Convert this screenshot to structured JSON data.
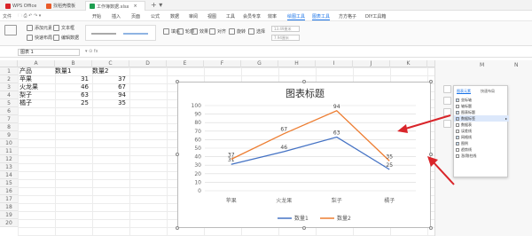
{
  "titlebar": {
    "app_label": "WPS Office",
    "tab1": "找稻壳模板",
    "tab2": "工作簿数据.xlsx"
  },
  "menu": [
    "文件",
    "开始",
    "插入",
    "页面",
    "公式",
    "数据",
    "审阅",
    "视图",
    "工具",
    "会员专享",
    "效率",
    "绘图工具",
    "图表工具",
    "方方格子",
    "DIY工具箱"
  ],
  "toolbar": {
    "add_element": "添加元素",
    "quick_layout": "快速布局",
    "text_box": "文本框",
    "edit_data": "编辑数据",
    "fill": "填充",
    "outline": "轮廓",
    "effect": "效果",
    "align": "对齐",
    "rotate": "旋转",
    "select": "选择",
    "width_label": "13.49厘米",
    "height_label": "7.94厘米"
  },
  "namebox": "图表 1",
  "columns": [
    "A",
    "B",
    "C",
    "D",
    "E",
    "F",
    "G",
    "H",
    "I",
    "J",
    "K",
    "L",
    "M",
    "N"
  ],
  "rows": [
    "1",
    "2",
    "3",
    "4",
    "5",
    "6",
    "7",
    "8",
    "9",
    "10",
    "11",
    "12",
    "13",
    "14",
    "15",
    "16",
    "17",
    "18",
    "19",
    "20"
  ],
  "table": {
    "header": [
      "产品",
      "数量1",
      "数量2"
    ],
    "data": [
      [
        "苹果",
        "31",
        "37"
      ],
      [
        "火龙果",
        "46",
        "67"
      ],
      [
        "梨子",
        "63",
        "94"
      ],
      [
        "橘子",
        "25",
        "35"
      ]
    ]
  },
  "chart_data": {
    "type": "line",
    "title": "图表标题",
    "categories": [
      "苹果",
      "火龙果",
      "梨子",
      "橘子"
    ],
    "series": [
      {
        "name": "数量1",
        "values": [
          31,
          46,
          63,
          25
        ],
        "color": "#4472c4"
      },
      {
        "name": "数量2",
        "values": [
          37,
          67,
          94,
          35
        ],
        "color": "#ed7d31"
      }
    ],
    "ylim": [
      0,
      100
    ],
    "yticks": [
      "0",
      "10",
      "20",
      "30",
      "40",
      "50",
      "60",
      "70",
      "80",
      "90",
      "100"
    ],
    "legend": "bottom",
    "grid": true
  },
  "panel": {
    "tab_elements": "图表元素",
    "tab_layout": "快速布局",
    "items": [
      {
        "label": "坐标轴",
        "checked": true
      },
      {
        "label": "轴标题",
        "checked": false
      },
      {
        "label": "图表标题",
        "checked": true
      },
      {
        "label": "数据标签",
        "checked": true
      },
      {
        "label": "数据表",
        "checked": false
      },
      {
        "label": "误差线",
        "checked": false
      },
      {
        "label": "网格线",
        "checked": true
      },
      {
        "label": "图例",
        "checked": true
      },
      {
        "label": "趋势线",
        "checked": false
      },
      {
        "label": "涨/跌柱线",
        "checked": false
      }
    ]
  },
  "colors": {
    "accent": "#1a73e8",
    "arrow": "#d9252a"
  }
}
